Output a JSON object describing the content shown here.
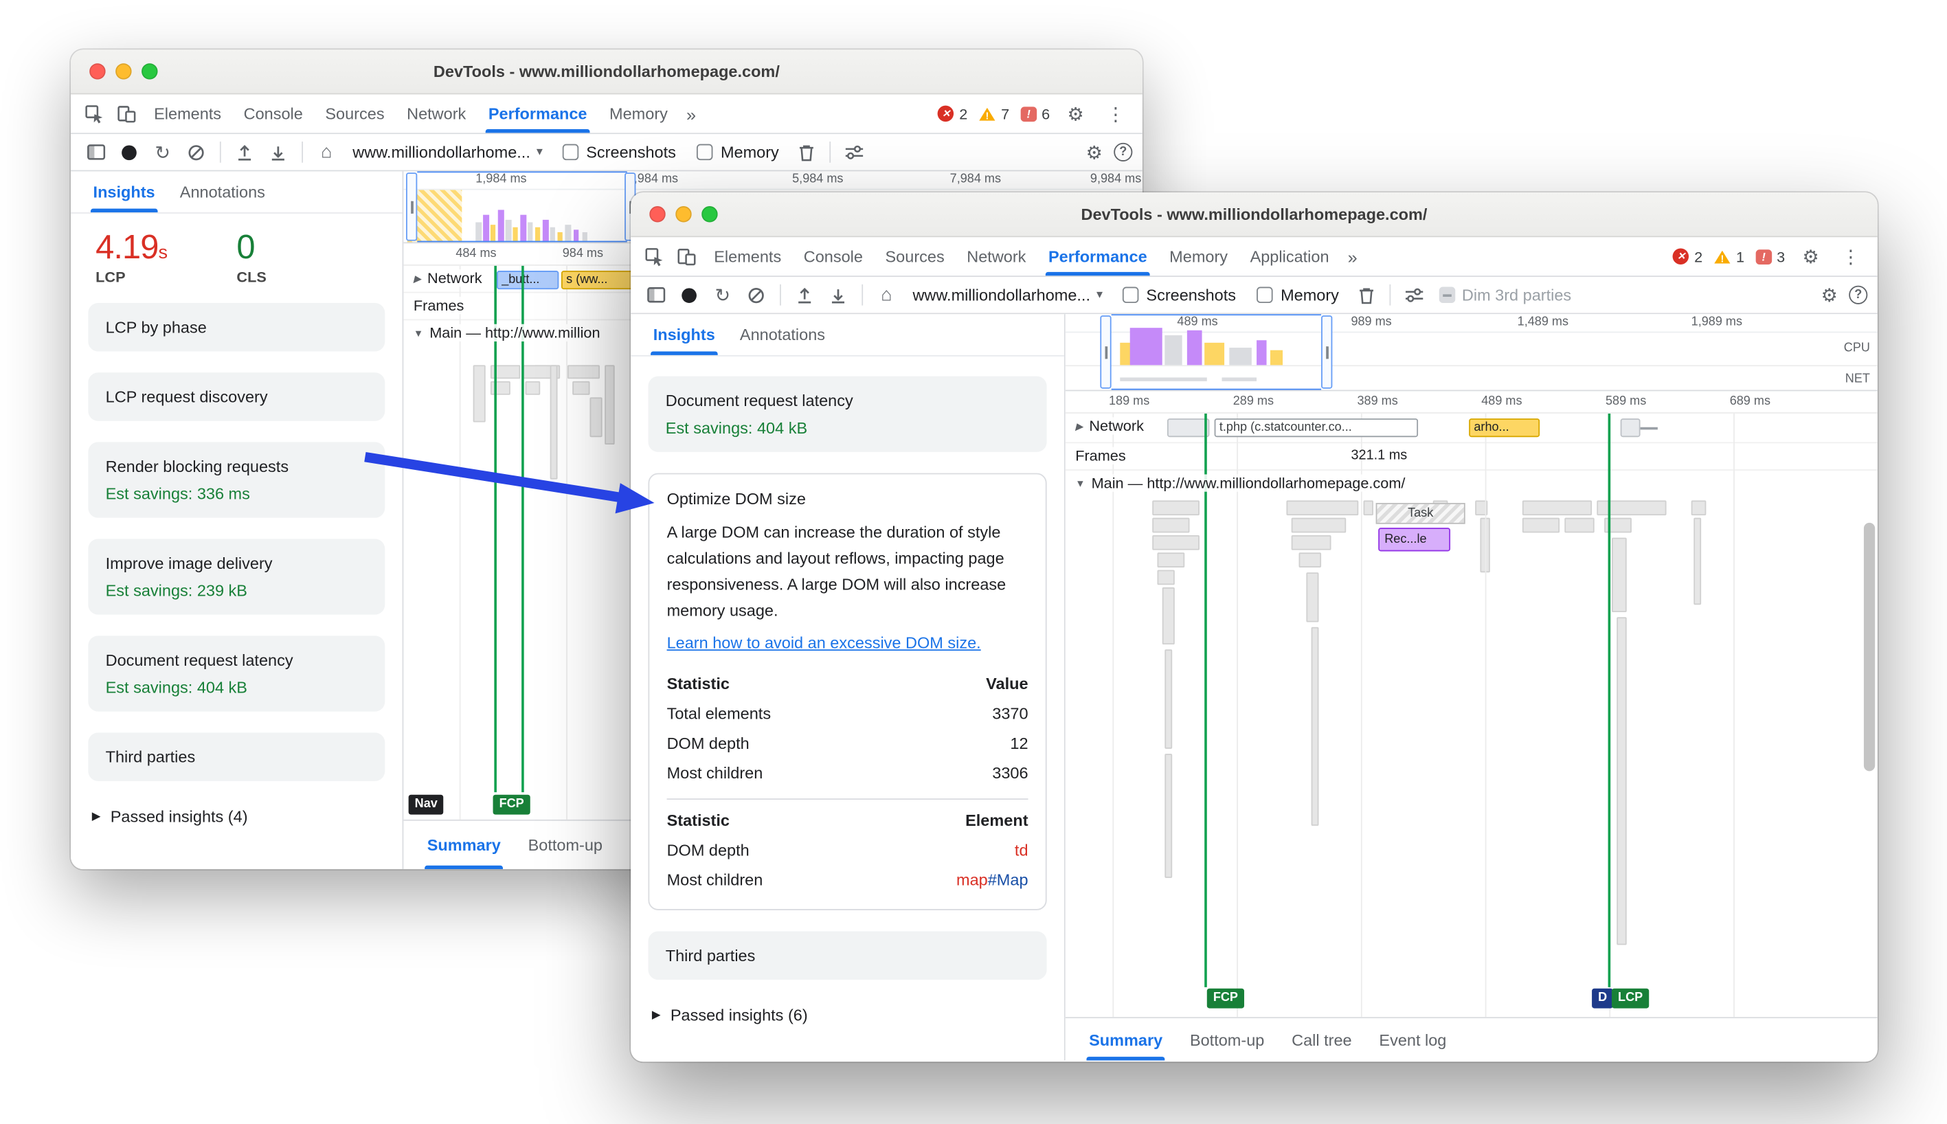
{
  "colors": {
    "accent": "#1a73e8",
    "bad": "#d93025",
    "good": "#188038",
    "arrow": "#2743e3",
    "tag": "#d93025",
    "eid": "#174ea6"
  },
  "shared": {
    "screenshots_label": "Screenshots",
    "memory_label": "Memory"
  },
  "back": {
    "title": "DevTools - www.milliondollarhomepage.com/",
    "tabs": [
      "Elements",
      "Console",
      "Sources",
      "Network",
      "Performance",
      "Memory"
    ],
    "more_tabs": "»",
    "badge_counts": {
      "errors": "2",
      "warnings": "7",
      "issues": "6"
    },
    "origin": "www.milliondollarhome...",
    "pane_tabs": [
      "Insights",
      "Annotations"
    ],
    "metrics": [
      {
        "value": "4.19",
        "unit": "s",
        "label": "LCP"
      },
      {
        "value": "0",
        "unit": "",
        "label": "CLS"
      }
    ],
    "insights": [
      {
        "title": "LCP by phase"
      },
      {
        "title": "LCP request discovery"
      },
      {
        "title": "Render blocking requests",
        "savings": "Est savings: 336 ms"
      },
      {
        "title": "Improve image delivery",
        "savings": "Est savings: 239 kB"
      },
      {
        "title": "Document request latency",
        "savings": "Est savings: 404 kB"
      },
      {
        "title": "Third parties"
      }
    ],
    "passed_insights": "Passed insights (4)",
    "overview_ruler": [
      "1,984 ms",
      "3,984 ms",
      "5,984 ms",
      "7,984 ms",
      "9,984 ms"
    ],
    "ruler": [
      "484 ms",
      "984 ms"
    ],
    "tracks": {
      "network": "Network",
      "frames": "Frames",
      "main": "Main — http://www.million"
    },
    "network_items": [
      {
        "label": "_butt..."
      },
      {
        "label": "s (ww..."
      }
    ],
    "markers": {
      "nav": "Nav",
      "fcp": "FCP"
    },
    "bottom_tabs": [
      "Summary",
      "Bottom-up"
    ]
  },
  "front": {
    "title": "DevTools - www.milliondollarhomepage.com/",
    "tabs": [
      "Elements",
      "Console",
      "Sources",
      "Network",
      "Performance",
      "Memory",
      "Application"
    ],
    "more_tabs": "»",
    "badge_counts": {
      "errors": "2",
      "warnings": "1",
      "issues": "3"
    },
    "origin": "www.milliondollarhome...",
    "dim_label": "Dim 3rd parties",
    "pane_tabs": [
      "Insights",
      "Annotations"
    ],
    "cards": {
      "doc_latency": {
        "title": "Document request latency",
        "savings": "Est savings: 404 kB"
      },
      "optimize": {
        "title": "Optimize DOM size",
        "body": "A large DOM can increase the duration of style calculations and layout reflows, impacting page responsiveness. A large DOM will also increase memory usage.",
        "link": "Learn how to avoid an excessive DOM size.",
        "stats_headers": [
          "Statistic",
          "Value"
        ],
        "stats": [
          [
            "Total elements",
            "3370"
          ],
          [
            "DOM depth",
            "12"
          ],
          [
            "Most children",
            "3306"
          ]
        ],
        "element_headers": [
          "Statistic",
          "Element"
        ],
        "elements": [
          {
            "label": "DOM depth",
            "tag": "td",
            "id": ""
          },
          {
            "label": "Most children",
            "tag": "map",
            "id": "#Map"
          }
        ]
      },
      "third_parties": {
        "title": "Third parties"
      },
      "passed_insights": "Passed insights (6)"
    },
    "timeline": {
      "overview_ruler": [
        "489 ms",
        "989 ms",
        "1,489 ms",
        "1,989 ms"
      ],
      "side_labels": [
        "CPU",
        "NET"
      ],
      "ruler": [
        "189 ms",
        "289 ms",
        "389 ms",
        "489 ms",
        "589 ms",
        "689 ms"
      ],
      "tracks": {
        "network": "Network",
        "frames": "Frames",
        "main": "Main — http://www.milliondollarhomepage.com/"
      },
      "frames_value": "321.1 ms",
      "network_items": [
        {
          "label": "t.php (c.statcounter.co..."
        },
        {
          "label": "arho..."
        }
      ],
      "task_label": "Task",
      "recalc_label": "Rec...le",
      "markers": {
        "fcp": "FCP",
        "dcl": "D",
        "lcp": "LCP"
      },
      "bottom_tabs": [
        "Summary",
        "Bottom-up",
        "Call tree",
        "Event log"
      ]
    }
  }
}
